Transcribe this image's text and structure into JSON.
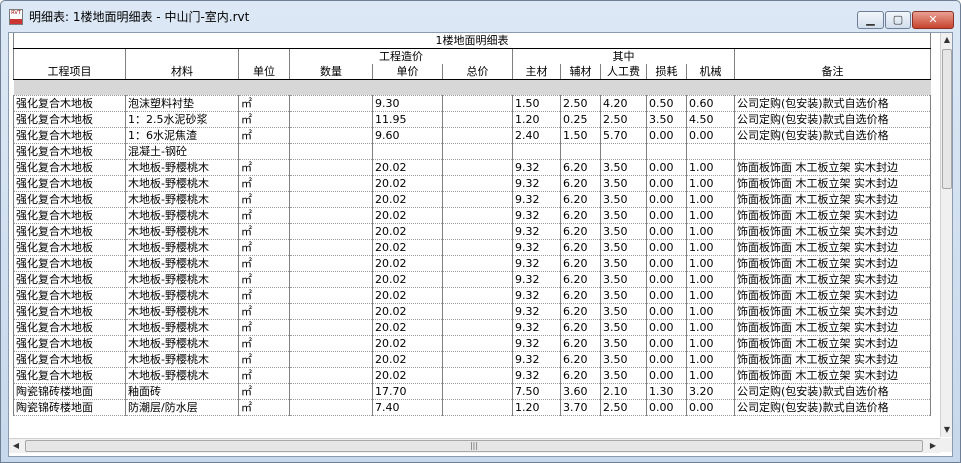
{
  "window": {
    "title": "明细表: 1楼地面明细表 - 中山门-室内.rvt",
    "icon_text": "RVT",
    "min_label": "▁",
    "max_label": "▢",
    "close_label": "✕"
  },
  "schedule": {
    "title": "1楼地面明细表",
    "group_cost": "工程造价",
    "group_detail": "其中",
    "headers": [
      "工程项目",
      "材料",
      "单位",
      "数量",
      "单价",
      "总价",
      "主材",
      "辅材",
      "人工费",
      "损耗",
      "机械",
      "备注"
    ],
    "rows": [
      [
        "强化复合木地板",
        "泡沫塑料衬垫",
        "㎡",
        "",
        "9.30",
        "",
        "1.50",
        "2.50",
        "4.20",
        "0.50",
        "0.60",
        "公司定购(包安装)款式自选价格"
      ],
      [
        "强化复合木地板",
        "1：2.5水泥砂浆",
        "㎡",
        "",
        "11.95",
        "",
        "1.20",
        "0.25",
        "2.50",
        "3.50",
        "4.50",
        "公司定购(包安装)款式自选价格"
      ],
      [
        "强化复合木地板",
        "1：6水泥焦渣",
        "㎡",
        "",
        "9.60",
        "",
        "2.40",
        "1.50",
        "5.70",
        "0.00",
        "0.00",
        "公司定购(包安装)款式自选价格"
      ],
      [
        "强化复合木地板",
        "混凝土-钢砼",
        "",
        "",
        "",
        "",
        "",
        "",
        "",
        "",
        "",
        ""
      ],
      [
        "强化复合木地板",
        "木地板-野樱桃木",
        "㎡",
        "",
        "20.02",
        "",
        "9.32",
        "6.20",
        "3.50",
        "0.00",
        "1.00",
        "饰面板饰面 木工板立架 实木封边"
      ],
      [
        "强化复合木地板",
        "木地板-野樱桃木",
        "㎡",
        "",
        "20.02",
        "",
        "9.32",
        "6.20",
        "3.50",
        "0.00",
        "1.00",
        "饰面板饰面 木工板立架 实木封边"
      ],
      [
        "强化复合木地板",
        "木地板-野樱桃木",
        "㎡",
        "",
        "20.02",
        "",
        "9.32",
        "6.20",
        "3.50",
        "0.00",
        "1.00",
        "饰面板饰面 木工板立架 实木封边"
      ],
      [
        "强化复合木地板",
        "木地板-野樱桃木",
        "㎡",
        "",
        "20.02",
        "",
        "9.32",
        "6.20",
        "3.50",
        "0.00",
        "1.00",
        "饰面板饰面 木工板立架 实木封边"
      ],
      [
        "强化复合木地板",
        "木地板-野樱桃木",
        "㎡",
        "",
        "20.02",
        "",
        "9.32",
        "6.20",
        "3.50",
        "0.00",
        "1.00",
        "饰面板饰面 木工板立架 实木封边"
      ],
      [
        "强化复合木地板",
        "木地板-野樱桃木",
        "㎡",
        "",
        "20.02",
        "",
        "9.32",
        "6.20",
        "3.50",
        "0.00",
        "1.00",
        "饰面板饰面 木工板立架 实木封边"
      ],
      [
        "强化复合木地板",
        "木地板-野樱桃木",
        "㎡",
        "",
        "20.02",
        "",
        "9.32",
        "6.20",
        "3.50",
        "0.00",
        "1.00",
        "饰面板饰面 木工板立架 实木封边"
      ],
      [
        "强化复合木地板",
        "木地板-野樱桃木",
        "㎡",
        "",
        "20.02",
        "",
        "9.32",
        "6.20",
        "3.50",
        "0.00",
        "1.00",
        "饰面板饰面 木工板立架 实木封边"
      ],
      [
        "强化复合木地板",
        "木地板-野樱桃木",
        "㎡",
        "",
        "20.02",
        "",
        "9.32",
        "6.20",
        "3.50",
        "0.00",
        "1.00",
        "饰面板饰面 木工板立架 实木封边"
      ],
      [
        "强化复合木地板",
        "木地板-野樱桃木",
        "㎡",
        "",
        "20.02",
        "",
        "9.32",
        "6.20",
        "3.50",
        "0.00",
        "1.00",
        "饰面板饰面 木工板立架 实木封边"
      ],
      [
        "强化复合木地板",
        "木地板-野樱桃木",
        "㎡",
        "",
        "20.02",
        "",
        "9.32",
        "6.20",
        "3.50",
        "0.00",
        "1.00",
        "饰面板饰面 木工板立架 实木封边"
      ],
      [
        "强化复合木地板",
        "木地板-野樱桃木",
        "㎡",
        "",
        "20.02",
        "",
        "9.32",
        "6.20",
        "3.50",
        "0.00",
        "1.00",
        "饰面板饰面 木工板立架 实木封边"
      ],
      [
        "强化复合木地板",
        "木地板-野樱桃木",
        "㎡",
        "",
        "20.02",
        "",
        "9.32",
        "6.20",
        "3.50",
        "0.00",
        "1.00",
        "饰面板饰面 木工板立架 实木封边"
      ],
      [
        "强化复合木地板",
        "木地板-野樱桃木",
        "㎡",
        "",
        "20.02",
        "",
        "9.32",
        "6.20",
        "3.50",
        "0.00",
        "1.00",
        "饰面板饰面 木工板立架 实木封边"
      ],
      [
        "陶瓷锦砖楼地面",
        "釉面砖",
        "㎡",
        "",
        "17.70",
        "",
        "7.50",
        "3.60",
        "2.10",
        "1.30",
        "3.20",
        "公司定购(包安装)款式自选价格"
      ],
      [
        "陶瓷锦砖楼地面",
        "防潮层/防水层",
        "㎡",
        "",
        "7.40",
        "",
        "1.20",
        "3.70",
        "2.50",
        "0.00",
        "0.00",
        "公司定购(包安装)款式自选价格"
      ]
    ]
  },
  "scrollbars": {
    "up": "▲",
    "down": "▼",
    "left": "◀",
    "right": "▶",
    "grip": "|||"
  }
}
